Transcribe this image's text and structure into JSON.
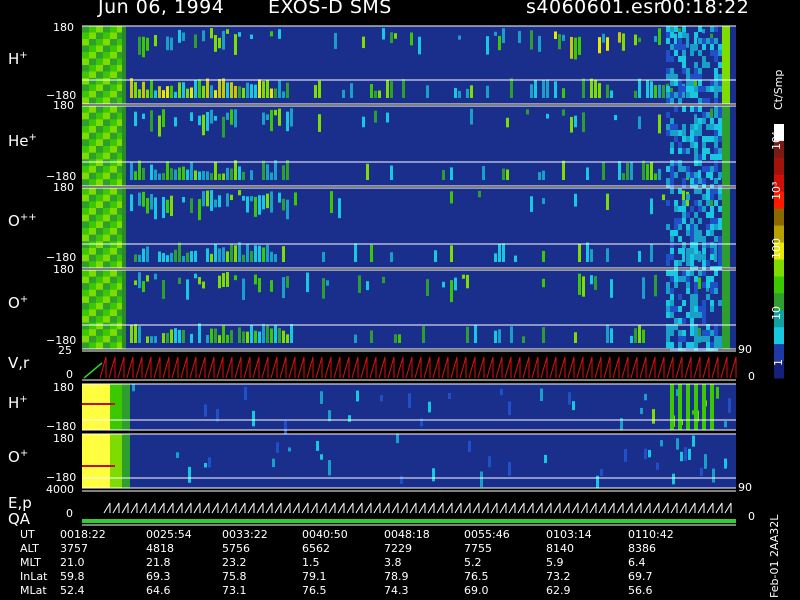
{
  "header": {
    "date": "Jun 06, 1994",
    "mission": "EXOS-D SMS",
    "file": "s4060601.esr",
    "time": "00:18:22"
  },
  "panels": [
    {
      "label": "H",
      "sup": "+",
      "top_tick": "180",
      "bottom_tick": "−180"
    },
    {
      "label": "He",
      "sup": "+",
      "top_tick": "180",
      "bottom_tick": "−180"
    },
    {
      "label": "O",
      "sup": "++",
      "top_tick": "180",
      "bottom_tick": "−180"
    },
    {
      "label": "O",
      "sup": "+",
      "top_tick": "180",
      "bottom_tick": "−180"
    }
  ],
  "vr_panel": {
    "label": "V,r",
    "top_tick": "25",
    "bottom_tick": "0",
    "right_tick": "90",
    "right_bottom": "0"
  },
  "lower_panels": [
    {
      "label": "H",
      "sup": "+",
      "top_tick": "180",
      "bottom_tick": "−180"
    },
    {
      "label": "O",
      "sup": "+",
      "top_tick": "180",
      "bottom_tick": "−180",
      "right_tick": "90"
    }
  ],
  "ep_panel": {
    "label1": "E,p",
    "label2": "QA",
    "top_tick": "4000",
    "bottom_tick": "0",
    "right_bottom": "0"
  },
  "colorbar": {
    "unit": "Ct/Smp",
    "ticks": [
      "10⁴",
      "10³",
      "100",
      "10",
      "1"
    ],
    "colors": [
      "#ffffff",
      "#7a1a14",
      "#a0140c",
      "#d01008",
      "#ff1a00",
      "#8a6a00",
      "#b8a000",
      "#e8e800",
      "#7fdc00",
      "#3cc800",
      "#2e9e2e",
      "#12a0a0",
      "#18c8e0",
      "#1e3aa8",
      "#14207a"
    ]
  },
  "footer": {
    "side_text": "Feb-01 2AA32L",
    "rows": [
      {
        "name": "UT",
        "values": [
          "0018:22",
          "0025:54",
          "0033:22",
          "0040:50",
          "0048:18",
          "0055:46",
          "0103:14",
          "0110:42"
        ]
      },
      {
        "name": "ALT",
        "values": [
          "3757",
          "4818",
          "5756",
          "6562",
          "7229",
          "7755",
          "8140",
          "8386"
        ]
      },
      {
        "name": "MLT",
        "values": [
          "21.0",
          "21.8",
          "23.2",
          "1.5",
          "3.8",
          "5.2",
          "5.9",
          "6.4"
        ]
      },
      {
        "name": "InLat",
        "values": [
          "59.8",
          "69.3",
          "75.8",
          "79.1",
          "78.9",
          "76.5",
          "73.2",
          "69.7"
        ]
      },
      {
        "name": "MLat",
        "values": [
          "52.4",
          "64.6",
          "73.1",
          "76.5",
          "74.3",
          "69.0",
          "62.9",
          "56.6"
        ]
      }
    ]
  },
  "chart_data": {
    "type": "heatmap",
    "x_ticks_ut": [
      "0018:22",
      "0025:54",
      "0033:22",
      "0040:50",
      "0048:18",
      "0055:46",
      "0103:14",
      "0110:42"
    ],
    "y_range_pitch_angle": [
      -180,
      180
    ],
    "color_scale": "log",
    "color_range": [
      1,
      10000
    ],
    "colorbar_unit": "Ct/Smp"
  }
}
